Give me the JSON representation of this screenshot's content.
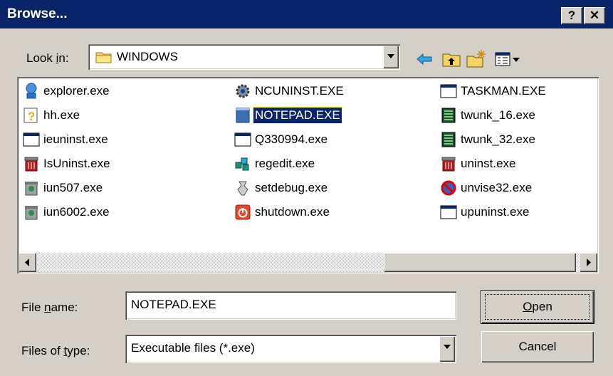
{
  "window": {
    "title": "Browse...",
    "help_label": "?",
    "close_label": "✕"
  },
  "lookin": {
    "label_pre": "Look ",
    "label_u": "i",
    "label_post": "n:",
    "value": "WINDOWS"
  },
  "toolbar": {
    "icons": [
      "back-icon",
      "up-folder-icon",
      "new-folder-icon",
      "view-menu-icon"
    ]
  },
  "files": [
    {
      "name": "explorer.exe",
      "icon": "explorer-icon"
    },
    {
      "name": "hh.exe",
      "icon": "help-exe-icon"
    },
    {
      "name": "ieuninst.exe",
      "icon": "window-exe-icon"
    },
    {
      "name": "IsUninst.exe",
      "icon": "uninstall-icon"
    },
    {
      "name": "iun507.exe",
      "icon": "installer-icon"
    },
    {
      "name": "iun6002.exe",
      "icon": "installer-icon"
    },
    {
      "name": "NCUNINST.EXE",
      "icon": "gear-icon"
    },
    {
      "name": "NOTEPAD.EXE",
      "icon": "notepad-icon",
      "selected": true
    },
    {
      "name": "Q330994.exe",
      "icon": "window-exe-icon"
    },
    {
      "name": "regedit.exe",
      "icon": "regedit-icon"
    },
    {
      "name": "setdebug.exe",
      "icon": "setdebug-icon"
    },
    {
      "name": "shutdown.exe",
      "icon": "shutdown-icon"
    },
    {
      "name": "TASKMAN.EXE",
      "icon": "window-exe-icon"
    },
    {
      "name": "twunk_16.exe",
      "icon": "scanner-icon"
    },
    {
      "name": "twunk_32.exe",
      "icon": "scanner-icon"
    },
    {
      "name": "uninst.exe",
      "icon": "uninstall-icon"
    },
    {
      "name": "unvise32.exe",
      "icon": "unvise-icon"
    },
    {
      "name": "upuninst.exe",
      "icon": "window-exe-icon"
    }
  ],
  "filename": {
    "label_pre": "File ",
    "label_u": "n",
    "label_post": "ame:",
    "value": "NOTEPAD.EXE"
  },
  "filetype": {
    "label_pre": "Files of ",
    "label_u": "t",
    "label_post": "ype:",
    "value": "Executable files (*.exe)"
  },
  "buttons": {
    "open_u": "O",
    "open_rest": "pen",
    "cancel": "Cancel"
  }
}
